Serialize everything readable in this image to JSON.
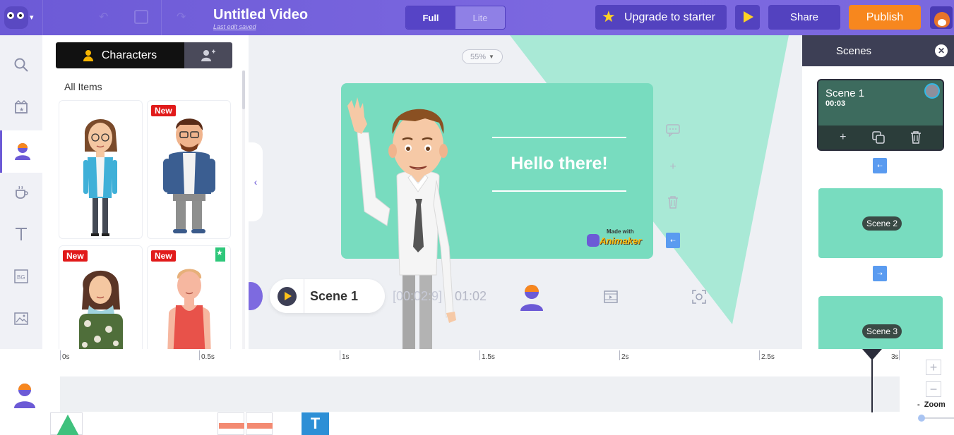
{
  "header": {
    "title": "Untitled Video",
    "subtitle": "Last edit saved",
    "mode_full": "Full",
    "mode_lite": "Lite",
    "upgrade_label": "Upgrade to starter",
    "share_label": "Share",
    "publish_label": "Publish"
  },
  "sidebar": {
    "items": [
      {
        "name": "search-icon",
        "glyph": "⌕"
      },
      {
        "name": "scene-icon",
        "glyph": "▣"
      },
      {
        "name": "character-icon",
        "glyph": "●"
      },
      {
        "name": "props-icon",
        "glyph": "☕"
      },
      {
        "name": "text-icon",
        "glyph": "T"
      },
      {
        "name": "background-icon",
        "glyph": "BG"
      },
      {
        "name": "image-icon",
        "glyph": "▨"
      }
    ]
  },
  "library": {
    "tab_label": "Characters",
    "section_label": "All Items",
    "badge_new": "New"
  },
  "canvas": {
    "zoom_label": "55%",
    "hello_text": "Hello there!",
    "watermark_small": "Made with",
    "watermark_big": "Animaker"
  },
  "scene_bar": {
    "scene_label": "Scene 1",
    "time_label": "[00:02:9]",
    "duration_label": "01:02"
  },
  "scenes_panel": {
    "title": "Scenes",
    "scenes": [
      {
        "name": "Scene 1",
        "time": "00:03"
      },
      {
        "name": "Scene 2"
      },
      {
        "name": "Scene 3"
      }
    ]
  },
  "timeline": {
    "ticks": [
      "0s",
      "0.5s",
      "1s",
      "1.5s",
      "2s",
      "2.5s",
      "3s"
    ],
    "zoom_label": "Zoom",
    "zoom_minus": "-"
  },
  "colors": {
    "brand": "#6c5ad6",
    "publish": "#f7871e",
    "stage": "#78dcbf"
  }
}
